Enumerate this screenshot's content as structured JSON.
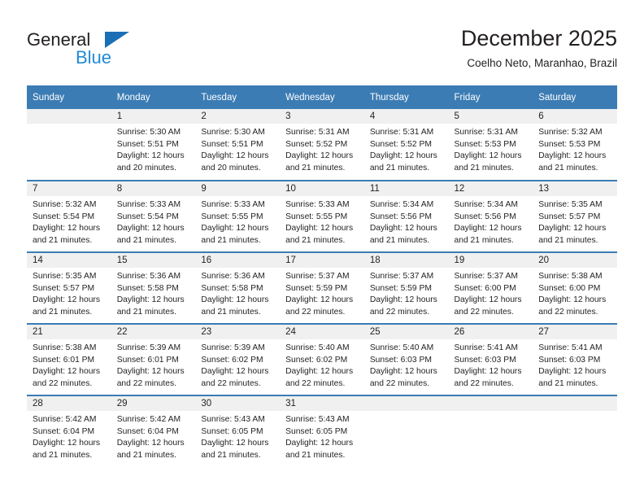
{
  "brand": {
    "name_part1": "General",
    "name_part2": "Blue",
    "triangle_color": "#1a6fb5",
    "blue_color": "#2389d6"
  },
  "header": {
    "title": "December 2025",
    "subtitle": "Coelho Neto, Maranhao, Brazil"
  },
  "theme": {
    "header_row_color": "#3c7cb4",
    "daynum_stripe_color": "#f0f0f0",
    "text_color": "#231f20"
  },
  "weekday_headers": [
    "Sunday",
    "Monday",
    "Tuesday",
    "Wednesday",
    "Thursday",
    "Friday",
    "Saturday"
  ],
  "labels": {
    "sunrise_prefix": "Sunrise:",
    "sunset_prefix": "Sunset:",
    "daylight_prefix": "Daylight:"
  },
  "weeks": [
    [
      {
        "day": "",
        "sunrise": "",
        "sunset": "",
        "daylight_line1": "",
        "daylight_line2": ""
      },
      {
        "day": "1",
        "sunrise": "Sunrise: 5:30 AM",
        "sunset": "Sunset: 5:51 PM",
        "daylight_line1": "Daylight: 12 hours",
        "daylight_line2": "and 20 minutes."
      },
      {
        "day": "2",
        "sunrise": "Sunrise: 5:30 AM",
        "sunset": "Sunset: 5:51 PM",
        "daylight_line1": "Daylight: 12 hours",
        "daylight_line2": "and 20 minutes."
      },
      {
        "day": "3",
        "sunrise": "Sunrise: 5:31 AM",
        "sunset": "Sunset: 5:52 PM",
        "daylight_line1": "Daylight: 12 hours",
        "daylight_line2": "and 21 minutes."
      },
      {
        "day": "4",
        "sunrise": "Sunrise: 5:31 AM",
        "sunset": "Sunset: 5:52 PM",
        "daylight_line1": "Daylight: 12 hours",
        "daylight_line2": "and 21 minutes."
      },
      {
        "day": "5",
        "sunrise": "Sunrise: 5:31 AM",
        "sunset": "Sunset: 5:53 PM",
        "daylight_line1": "Daylight: 12 hours",
        "daylight_line2": "and 21 minutes."
      },
      {
        "day": "6",
        "sunrise": "Sunrise: 5:32 AM",
        "sunset": "Sunset: 5:53 PM",
        "daylight_line1": "Daylight: 12 hours",
        "daylight_line2": "and 21 minutes."
      }
    ],
    [
      {
        "day": "7",
        "sunrise": "Sunrise: 5:32 AM",
        "sunset": "Sunset: 5:54 PM",
        "daylight_line1": "Daylight: 12 hours",
        "daylight_line2": "and 21 minutes."
      },
      {
        "day": "8",
        "sunrise": "Sunrise: 5:33 AM",
        "sunset": "Sunset: 5:54 PM",
        "daylight_line1": "Daylight: 12 hours",
        "daylight_line2": "and 21 minutes."
      },
      {
        "day": "9",
        "sunrise": "Sunrise: 5:33 AM",
        "sunset": "Sunset: 5:55 PM",
        "daylight_line1": "Daylight: 12 hours",
        "daylight_line2": "and 21 minutes."
      },
      {
        "day": "10",
        "sunrise": "Sunrise: 5:33 AM",
        "sunset": "Sunset: 5:55 PM",
        "daylight_line1": "Daylight: 12 hours",
        "daylight_line2": "and 21 minutes."
      },
      {
        "day": "11",
        "sunrise": "Sunrise: 5:34 AM",
        "sunset": "Sunset: 5:56 PM",
        "daylight_line1": "Daylight: 12 hours",
        "daylight_line2": "and 21 minutes."
      },
      {
        "day": "12",
        "sunrise": "Sunrise: 5:34 AM",
        "sunset": "Sunset: 5:56 PM",
        "daylight_line1": "Daylight: 12 hours",
        "daylight_line2": "and 21 minutes."
      },
      {
        "day": "13",
        "sunrise": "Sunrise: 5:35 AM",
        "sunset": "Sunset: 5:57 PM",
        "daylight_line1": "Daylight: 12 hours",
        "daylight_line2": "and 21 minutes."
      }
    ],
    [
      {
        "day": "14",
        "sunrise": "Sunrise: 5:35 AM",
        "sunset": "Sunset: 5:57 PM",
        "daylight_line1": "Daylight: 12 hours",
        "daylight_line2": "and 21 minutes."
      },
      {
        "day": "15",
        "sunrise": "Sunrise: 5:36 AM",
        "sunset": "Sunset: 5:58 PM",
        "daylight_line1": "Daylight: 12 hours",
        "daylight_line2": "and 21 minutes."
      },
      {
        "day": "16",
        "sunrise": "Sunrise: 5:36 AM",
        "sunset": "Sunset: 5:58 PM",
        "daylight_line1": "Daylight: 12 hours",
        "daylight_line2": "and 21 minutes."
      },
      {
        "day": "17",
        "sunrise": "Sunrise: 5:37 AM",
        "sunset": "Sunset: 5:59 PM",
        "daylight_line1": "Daylight: 12 hours",
        "daylight_line2": "and 22 minutes."
      },
      {
        "day": "18",
        "sunrise": "Sunrise: 5:37 AM",
        "sunset": "Sunset: 5:59 PM",
        "daylight_line1": "Daylight: 12 hours",
        "daylight_line2": "and 22 minutes."
      },
      {
        "day": "19",
        "sunrise": "Sunrise: 5:37 AM",
        "sunset": "Sunset: 6:00 PM",
        "daylight_line1": "Daylight: 12 hours",
        "daylight_line2": "and 22 minutes."
      },
      {
        "day": "20",
        "sunrise": "Sunrise: 5:38 AM",
        "sunset": "Sunset: 6:00 PM",
        "daylight_line1": "Daylight: 12 hours",
        "daylight_line2": "and 22 minutes."
      }
    ],
    [
      {
        "day": "21",
        "sunrise": "Sunrise: 5:38 AM",
        "sunset": "Sunset: 6:01 PM",
        "daylight_line1": "Daylight: 12 hours",
        "daylight_line2": "and 22 minutes."
      },
      {
        "day": "22",
        "sunrise": "Sunrise: 5:39 AM",
        "sunset": "Sunset: 6:01 PM",
        "daylight_line1": "Daylight: 12 hours",
        "daylight_line2": "and 22 minutes."
      },
      {
        "day": "23",
        "sunrise": "Sunrise: 5:39 AM",
        "sunset": "Sunset: 6:02 PM",
        "daylight_line1": "Daylight: 12 hours",
        "daylight_line2": "and 22 minutes."
      },
      {
        "day": "24",
        "sunrise": "Sunrise: 5:40 AM",
        "sunset": "Sunset: 6:02 PM",
        "daylight_line1": "Daylight: 12 hours",
        "daylight_line2": "and 22 minutes."
      },
      {
        "day": "25",
        "sunrise": "Sunrise: 5:40 AM",
        "sunset": "Sunset: 6:03 PM",
        "daylight_line1": "Daylight: 12 hours",
        "daylight_line2": "and 22 minutes."
      },
      {
        "day": "26",
        "sunrise": "Sunrise: 5:41 AM",
        "sunset": "Sunset: 6:03 PM",
        "daylight_line1": "Daylight: 12 hours",
        "daylight_line2": "and 22 minutes."
      },
      {
        "day": "27",
        "sunrise": "Sunrise: 5:41 AM",
        "sunset": "Sunset: 6:03 PM",
        "daylight_line1": "Daylight: 12 hours",
        "daylight_line2": "and 21 minutes."
      }
    ],
    [
      {
        "day": "28",
        "sunrise": "Sunrise: 5:42 AM",
        "sunset": "Sunset: 6:04 PM",
        "daylight_line1": "Daylight: 12 hours",
        "daylight_line2": "and 21 minutes."
      },
      {
        "day": "29",
        "sunrise": "Sunrise: 5:42 AM",
        "sunset": "Sunset: 6:04 PM",
        "daylight_line1": "Daylight: 12 hours",
        "daylight_line2": "and 21 minutes."
      },
      {
        "day": "30",
        "sunrise": "Sunrise: 5:43 AM",
        "sunset": "Sunset: 6:05 PM",
        "daylight_line1": "Daylight: 12 hours",
        "daylight_line2": "and 21 minutes."
      },
      {
        "day": "31",
        "sunrise": "Sunrise: 5:43 AM",
        "sunset": "Sunset: 6:05 PM",
        "daylight_line1": "Daylight: 12 hours",
        "daylight_line2": "and 21 minutes."
      },
      {
        "day": "",
        "sunrise": "",
        "sunset": "",
        "daylight_line1": "",
        "daylight_line2": ""
      },
      {
        "day": "",
        "sunrise": "",
        "sunset": "",
        "daylight_line1": "",
        "daylight_line2": ""
      },
      {
        "day": "",
        "sunrise": "",
        "sunset": "",
        "daylight_line1": "",
        "daylight_line2": ""
      }
    ]
  ]
}
